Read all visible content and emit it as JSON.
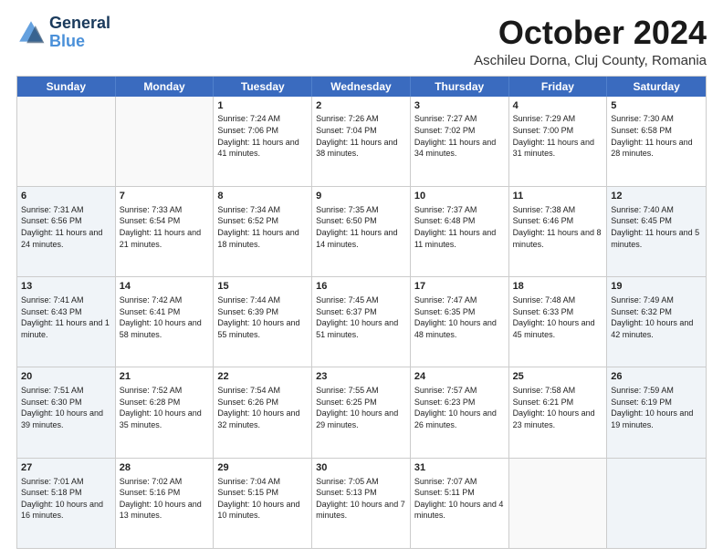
{
  "header": {
    "logo_line1": "General",
    "logo_line2": "Blue",
    "month": "October 2024",
    "location": "Aschileu Dorna, Cluj County, Romania"
  },
  "weekdays": [
    "Sunday",
    "Monday",
    "Tuesday",
    "Wednesday",
    "Thursday",
    "Friday",
    "Saturday"
  ],
  "rows": [
    [
      {
        "day": "",
        "info": "",
        "shaded": false
      },
      {
        "day": "",
        "info": "",
        "shaded": false
      },
      {
        "day": "1",
        "info": "Sunrise: 7:24 AM\nSunset: 7:06 PM\nDaylight: 11 hours and 41 minutes.",
        "shaded": false
      },
      {
        "day": "2",
        "info": "Sunrise: 7:26 AM\nSunset: 7:04 PM\nDaylight: 11 hours and 38 minutes.",
        "shaded": false
      },
      {
        "day": "3",
        "info": "Sunrise: 7:27 AM\nSunset: 7:02 PM\nDaylight: 11 hours and 34 minutes.",
        "shaded": false
      },
      {
        "day": "4",
        "info": "Sunrise: 7:29 AM\nSunset: 7:00 PM\nDaylight: 11 hours and 31 minutes.",
        "shaded": false
      },
      {
        "day": "5",
        "info": "Sunrise: 7:30 AM\nSunset: 6:58 PM\nDaylight: 11 hours and 28 minutes.",
        "shaded": false
      }
    ],
    [
      {
        "day": "6",
        "info": "Sunrise: 7:31 AM\nSunset: 6:56 PM\nDaylight: 11 hours and 24 minutes.",
        "shaded": true
      },
      {
        "day": "7",
        "info": "Sunrise: 7:33 AM\nSunset: 6:54 PM\nDaylight: 11 hours and 21 minutes.",
        "shaded": false
      },
      {
        "day": "8",
        "info": "Sunrise: 7:34 AM\nSunset: 6:52 PM\nDaylight: 11 hours and 18 minutes.",
        "shaded": false
      },
      {
        "day": "9",
        "info": "Sunrise: 7:35 AM\nSunset: 6:50 PM\nDaylight: 11 hours and 14 minutes.",
        "shaded": false
      },
      {
        "day": "10",
        "info": "Sunrise: 7:37 AM\nSunset: 6:48 PM\nDaylight: 11 hours and 11 minutes.",
        "shaded": false
      },
      {
        "day": "11",
        "info": "Sunrise: 7:38 AM\nSunset: 6:46 PM\nDaylight: 11 hours and 8 minutes.",
        "shaded": false
      },
      {
        "day": "12",
        "info": "Sunrise: 7:40 AM\nSunset: 6:45 PM\nDaylight: 11 hours and 5 minutes.",
        "shaded": true
      }
    ],
    [
      {
        "day": "13",
        "info": "Sunrise: 7:41 AM\nSunset: 6:43 PM\nDaylight: 11 hours and 1 minute.",
        "shaded": true
      },
      {
        "day": "14",
        "info": "Sunrise: 7:42 AM\nSunset: 6:41 PM\nDaylight: 10 hours and 58 minutes.",
        "shaded": false
      },
      {
        "day": "15",
        "info": "Sunrise: 7:44 AM\nSunset: 6:39 PM\nDaylight: 10 hours and 55 minutes.",
        "shaded": false
      },
      {
        "day": "16",
        "info": "Sunrise: 7:45 AM\nSunset: 6:37 PM\nDaylight: 10 hours and 51 minutes.",
        "shaded": false
      },
      {
        "day": "17",
        "info": "Sunrise: 7:47 AM\nSunset: 6:35 PM\nDaylight: 10 hours and 48 minutes.",
        "shaded": false
      },
      {
        "day": "18",
        "info": "Sunrise: 7:48 AM\nSunset: 6:33 PM\nDaylight: 10 hours and 45 minutes.",
        "shaded": false
      },
      {
        "day": "19",
        "info": "Sunrise: 7:49 AM\nSunset: 6:32 PM\nDaylight: 10 hours and 42 minutes.",
        "shaded": true
      }
    ],
    [
      {
        "day": "20",
        "info": "Sunrise: 7:51 AM\nSunset: 6:30 PM\nDaylight: 10 hours and 39 minutes.",
        "shaded": true
      },
      {
        "day": "21",
        "info": "Sunrise: 7:52 AM\nSunset: 6:28 PM\nDaylight: 10 hours and 35 minutes.",
        "shaded": false
      },
      {
        "day": "22",
        "info": "Sunrise: 7:54 AM\nSunset: 6:26 PM\nDaylight: 10 hours and 32 minutes.",
        "shaded": false
      },
      {
        "day": "23",
        "info": "Sunrise: 7:55 AM\nSunset: 6:25 PM\nDaylight: 10 hours and 29 minutes.",
        "shaded": false
      },
      {
        "day": "24",
        "info": "Sunrise: 7:57 AM\nSunset: 6:23 PM\nDaylight: 10 hours and 26 minutes.",
        "shaded": false
      },
      {
        "day": "25",
        "info": "Sunrise: 7:58 AM\nSunset: 6:21 PM\nDaylight: 10 hours and 23 minutes.",
        "shaded": false
      },
      {
        "day": "26",
        "info": "Sunrise: 7:59 AM\nSunset: 6:19 PM\nDaylight: 10 hours and 19 minutes.",
        "shaded": true
      }
    ],
    [
      {
        "day": "27",
        "info": "Sunrise: 7:01 AM\nSunset: 5:18 PM\nDaylight: 10 hours and 16 minutes.",
        "shaded": true
      },
      {
        "day": "28",
        "info": "Sunrise: 7:02 AM\nSunset: 5:16 PM\nDaylight: 10 hours and 13 minutes.",
        "shaded": false
      },
      {
        "day": "29",
        "info": "Sunrise: 7:04 AM\nSunset: 5:15 PM\nDaylight: 10 hours and 10 minutes.",
        "shaded": false
      },
      {
        "day": "30",
        "info": "Sunrise: 7:05 AM\nSunset: 5:13 PM\nDaylight: 10 hours and 7 minutes.",
        "shaded": false
      },
      {
        "day": "31",
        "info": "Sunrise: 7:07 AM\nSunset: 5:11 PM\nDaylight: 10 hours and 4 minutes.",
        "shaded": false
      },
      {
        "day": "",
        "info": "",
        "shaded": false
      },
      {
        "day": "",
        "info": "",
        "shaded": true
      }
    ]
  ]
}
